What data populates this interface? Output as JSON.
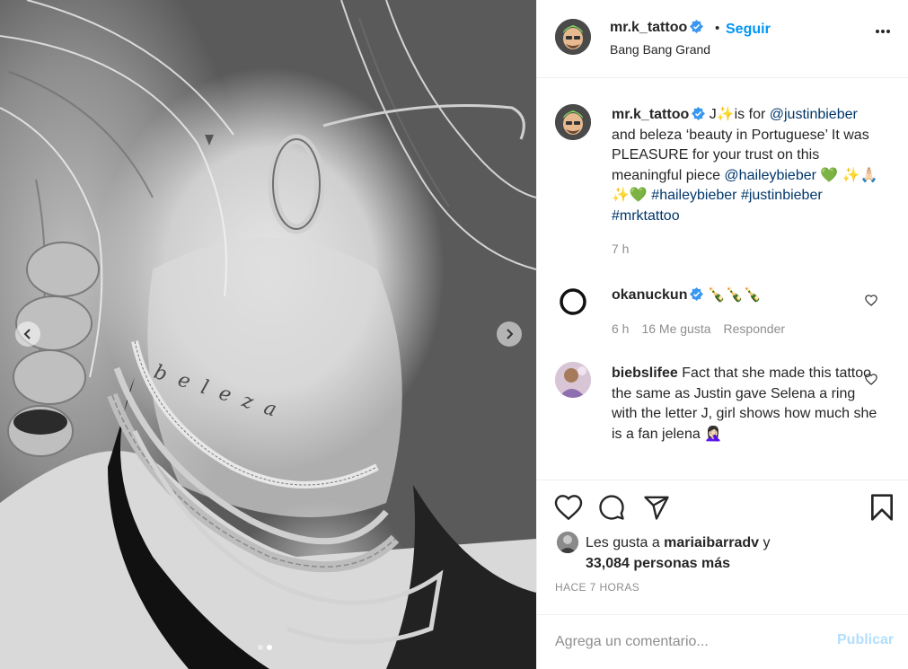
{
  "post": {
    "username": "mr.k_tattoo",
    "follow_label": "Seguir",
    "separator": "•",
    "location": "Bang Bang Grand"
  },
  "caption": {
    "username": "mr.k_tattoo",
    "text_1": "J✨is for ",
    "mention_1": "@justinbieber",
    "text_2": " and beleza ‘beauty in Portuguese’ It was PLEASURE for your trust on this meaningful piece ",
    "mention_2": "@haileybieber",
    "text_3": " 💚 ✨🙏🏻✨💚 ",
    "hashtag_1": "#haileybieber",
    "hashtag_2": "#justinbieber",
    "hashtag_3": "#mrktattoo",
    "time": "7 h"
  },
  "comments": [
    {
      "username": "okanuckun",
      "text": "🍾🍾🍾",
      "time": "6 h",
      "likes": "16 Me gusta",
      "reply": "Responder"
    },
    {
      "username": "biebslifee",
      "text": "Fact that she made this tattoo the same as Justin gave Selena a ring with the letter J, girl shows how much she is a fan jelena 🤦🏻‍♀️"
    }
  ],
  "likes": {
    "prefix": "Les gusta a ",
    "user": "mariaibarradv",
    "connector": " y",
    "count": "33,084 personas más"
  },
  "timestamp": "Hace 7 horas",
  "comment_box": {
    "placeholder": "Agrega un comentario...",
    "publish_label": "Publicar"
  },
  "photo": {
    "slide_count": 2,
    "active_slide": 2,
    "neck_tattoo_text": "beleza"
  },
  "colors": {
    "link_blue": "#0095f6",
    "mention": "#00376b",
    "verified": "#3897f0",
    "publish_disabled": "#b2dffc",
    "meta_grey": "#8e8e8e"
  },
  "icons": [
    "verified-badge-icon",
    "more-options-icon",
    "heart-icon",
    "comment-icon",
    "share-icon",
    "bookmark-icon",
    "chevron-left-icon",
    "chevron-right-icon"
  ]
}
